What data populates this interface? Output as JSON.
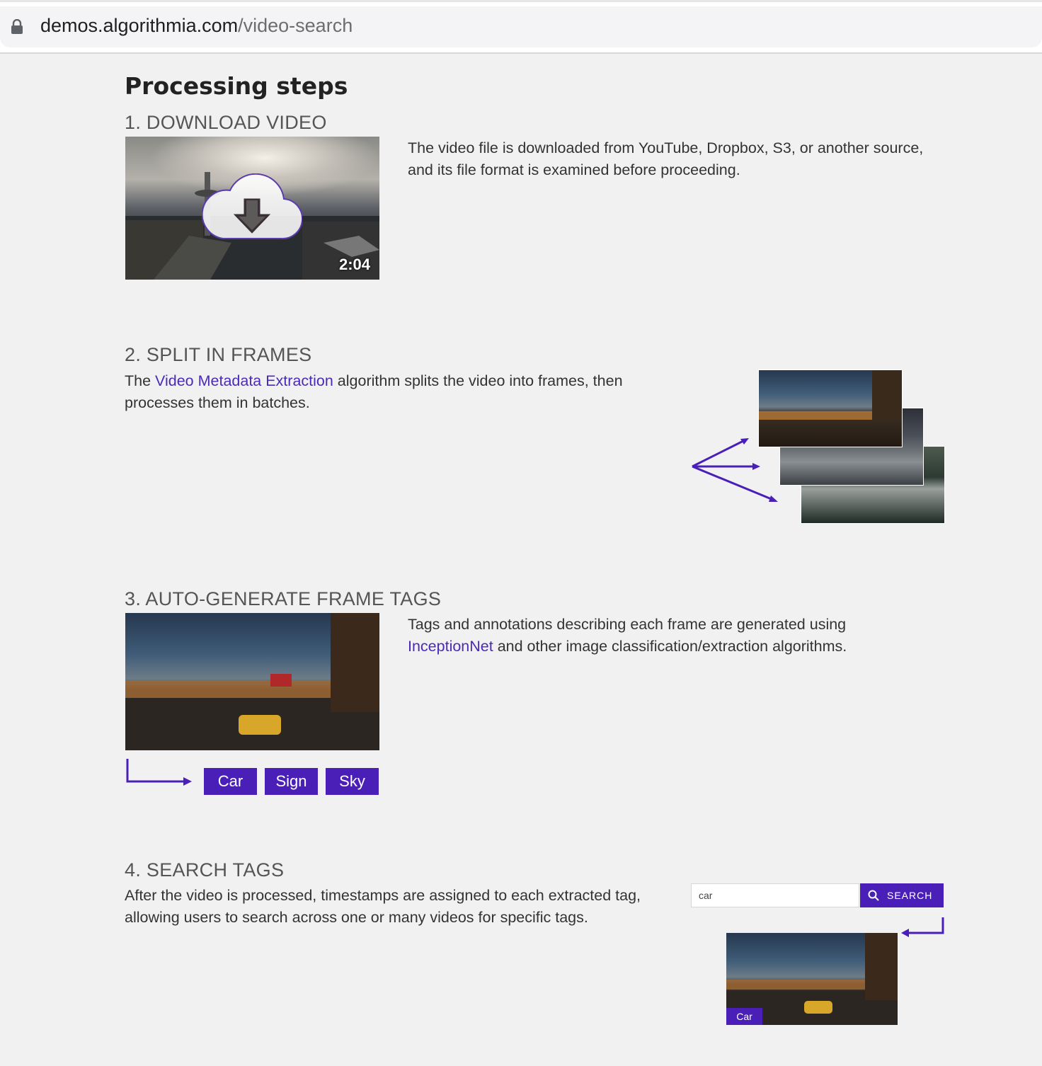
{
  "browser": {
    "url_host": "demos.algorithmia.com",
    "url_path": "/video-search",
    "lock_icon": "lock-icon"
  },
  "page": {
    "heading": "Processing steps",
    "accent_color": "#4a1fb8"
  },
  "steps": [
    {
      "title": "1. DOWNLOAD VIDEO",
      "text": "The video file is downloaded from YouTube, Dropbox, S3, or another source, and its file format is examined before proceeding.",
      "video_duration": "2:04",
      "icon": "cloud-download-icon"
    },
    {
      "title": "2. SPLIT IN FRAMES",
      "text_before": "The ",
      "link": "Video Metadata Extraction",
      "text_after": " algorithm splits the video into frames, then processes them in batches."
    },
    {
      "title": "3. AUTO-GENERATE FRAME TAGS",
      "text_before": "Tags and annotations describing each frame are generated using ",
      "link": "InceptionNet",
      "text_after": " and other image classification/extraction algorithms.",
      "tags": [
        "Car",
        "Sign",
        "Sky"
      ]
    },
    {
      "title": "4. SEARCH TAGS",
      "text": "After the video is processed, timestamps are assigned to each extracted tag, allowing users to search across one or many videos for specific tags.",
      "search_value": "car",
      "search_button": "SEARCH",
      "result_tag": "Car"
    }
  ]
}
